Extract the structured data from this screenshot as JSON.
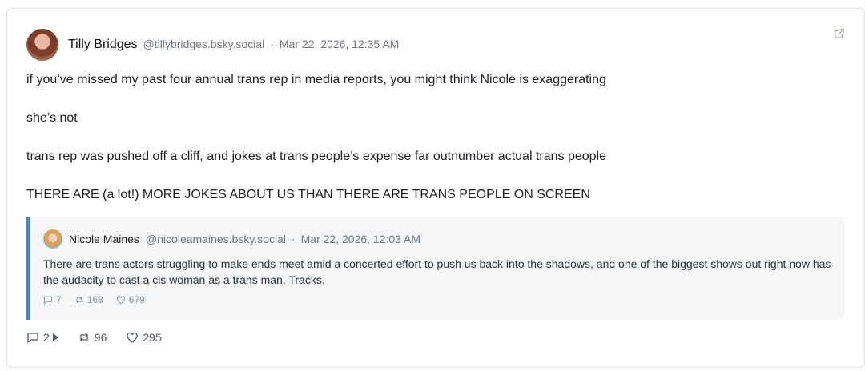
{
  "post": {
    "author": {
      "display_name": "Tilly Bridges",
      "handle": "@tillybridges.bsky.social",
      "separator": "·",
      "timestamp": "Mar 22, 2026, 12:35 AM"
    },
    "paragraphs": [
      "if you’ve missed my past four annual trans rep in media reports, you might think Nicole is exaggerating",
      "she’s not",
      "trans rep was pushed off a cliff, and jokes at trans people’s expense far outnumber actual trans people",
      "THERE ARE (a lot!) MORE JOKES ABOUT US THAN THERE ARE TRANS PEOPLE ON SCREEN"
    ],
    "actions": {
      "replies": "2",
      "reposts": "96",
      "likes": "295"
    },
    "icons": {
      "external": "external-link-icon",
      "reply": "reply-icon",
      "repost": "repost-icon",
      "like": "heart-icon"
    }
  },
  "quote": {
    "author": {
      "display_name": "Nicole Maines",
      "handle": "@nicoleamaines.bsky.social",
      "separator": "·",
      "timestamp": "Mar 22, 2026, 12:03 AM"
    },
    "text": "There are trans actors struggling to make ends meet amid a concerted effort to push us back into the shadows, and one of the biggest shows out right now has the audacity to cast a cis woman as a trans man. Tracks.",
    "stats": {
      "replies": "7",
      "reposts": "168",
      "likes": "679"
    }
  },
  "colors": {
    "accent": "#3b82f6",
    "muted": "#6f7781",
    "border": "#dfe3e8",
    "quote_bg": "#f5f6f7"
  }
}
